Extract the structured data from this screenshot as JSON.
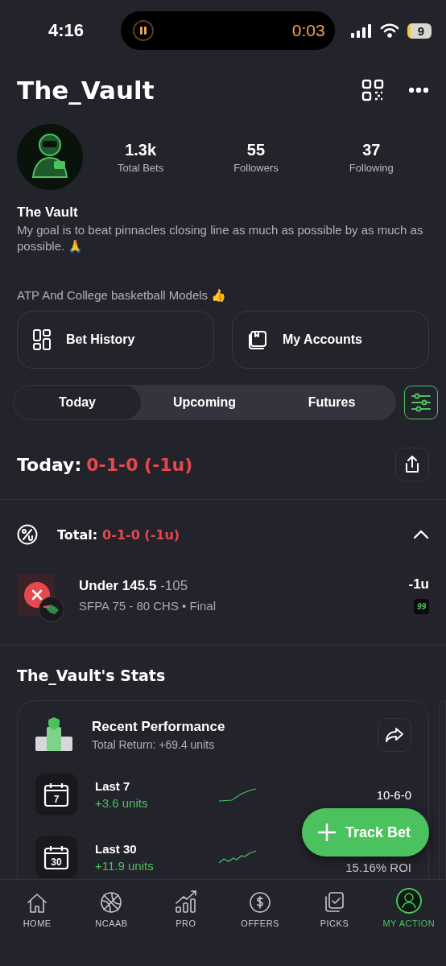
{
  "status_bar": {
    "time": "4:16",
    "timer": "0:03",
    "battery": "9"
  },
  "header": {
    "title": "The_Vault"
  },
  "profile": {
    "stats": [
      {
        "value": "1.3k",
        "label": "Total Bets"
      },
      {
        "value": "55",
        "label": "Followers"
      },
      {
        "value": "37",
        "label": "Following"
      }
    ],
    "name": "The Vault",
    "bio": "My goal is to beat pinnacles closing line as much as possible by as much as possible. 🙏",
    "tagline": "ATP And College basketball Models 👍"
  },
  "actions": [
    {
      "kind": "history",
      "label": "Bet History"
    },
    {
      "kind": "accounts",
      "label": "My Accounts"
    }
  ],
  "tabs": [
    {
      "label": "Today",
      "selected": true
    },
    {
      "label": "Upcoming",
      "selected": false
    },
    {
      "label": "Futures",
      "selected": false
    }
  ],
  "today": {
    "label": "Today:",
    "record": "0-1-0 (-1u)"
  },
  "group": {
    "label": "Total:",
    "record": "0-1-0 (-1u)",
    "expanded": true,
    "bets": [
      {
        "pick": "Under 145.5",
        "odds": "-105",
        "detail": "SFPA 75 - 80 CHS • Final",
        "result": "-1u",
        "lost": true,
        "badge": "99"
      }
    ]
  },
  "stats": {
    "title": "The_Vault's Stats",
    "card": {
      "title": "Recent Performance",
      "subtitle": "Total Return: +69.4 units",
      "rows": [
        {
          "day": "7",
          "label": "Last 7",
          "units": "+3.6 units",
          "record": "10-6-0"
        },
        {
          "day": "30",
          "label": "Last 30",
          "units": "+11.9 units",
          "roi": "15.16% ROI"
        }
      ]
    }
  },
  "fab": {
    "label": "Track Bet"
  },
  "nav": [
    {
      "kind": "home",
      "label": "HOME",
      "selected": false
    },
    {
      "kind": "ball",
      "label": "NCAAB",
      "selected": false
    },
    {
      "kind": "pro",
      "label": "PRO",
      "selected": false
    },
    {
      "kind": "offers",
      "label": "OFFERS",
      "selected": false
    },
    {
      "kind": "picks",
      "label": "PICKS",
      "selected": false
    },
    {
      "kind": "avatar",
      "label": "MY ACTION",
      "selected": true
    }
  ]
}
